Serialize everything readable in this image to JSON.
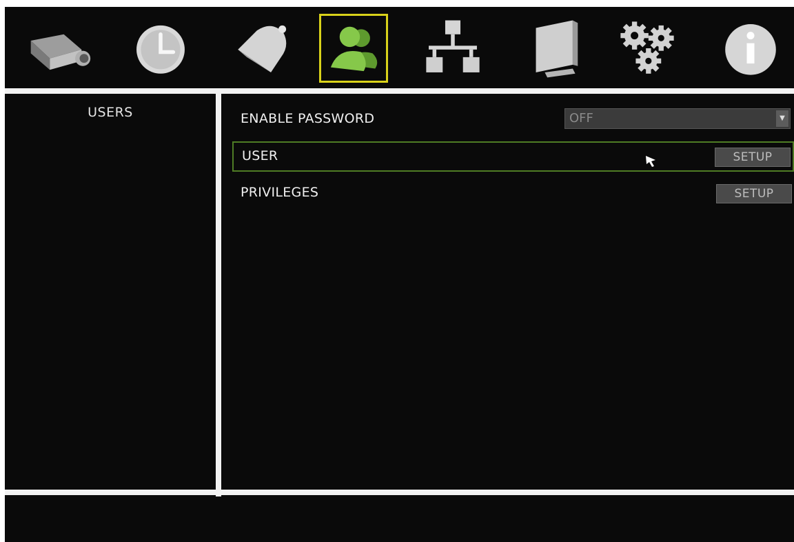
{
  "toolbar": {
    "icons": [
      {
        "name": "camera-icon",
        "color": "#b8b8b8"
      },
      {
        "name": "clock-icon",
        "color": "#d6d6d6"
      },
      {
        "name": "bell-icon",
        "color": "#d6d6d6"
      },
      {
        "name": "users-icon",
        "color": "#7fc242",
        "selected": true
      },
      {
        "name": "network-icon",
        "color": "#cfcfcf"
      },
      {
        "name": "monitor-icon",
        "color": "#cfcfcf"
      },
      {
        "name": "gears-icon",
        "color": "#cfcfcf"
      },
      {
        "name": "info-icon",
        "color": "#d6d6d6"
      }
    ],
    "selection_color": "#d9d21a"
  },
  "sidebar": {
    "title": "USERS"
  },
  "settings": {
    "enable_password": {
      "label": "ENABLE PASSWORD",
      "value": "OFF"
    },
    "user": {
      "label": "USER",
      "button": "SETUP"
    },
    "privileges": {
      "label": "PRIVILEGES",
      "button": "SETUP"
    }
  },
  "theme": {
    "background": "#0a0a0a",
    "divider": "#f2f2f2",
    "focus_border": "#4f7d25"
  }
}
